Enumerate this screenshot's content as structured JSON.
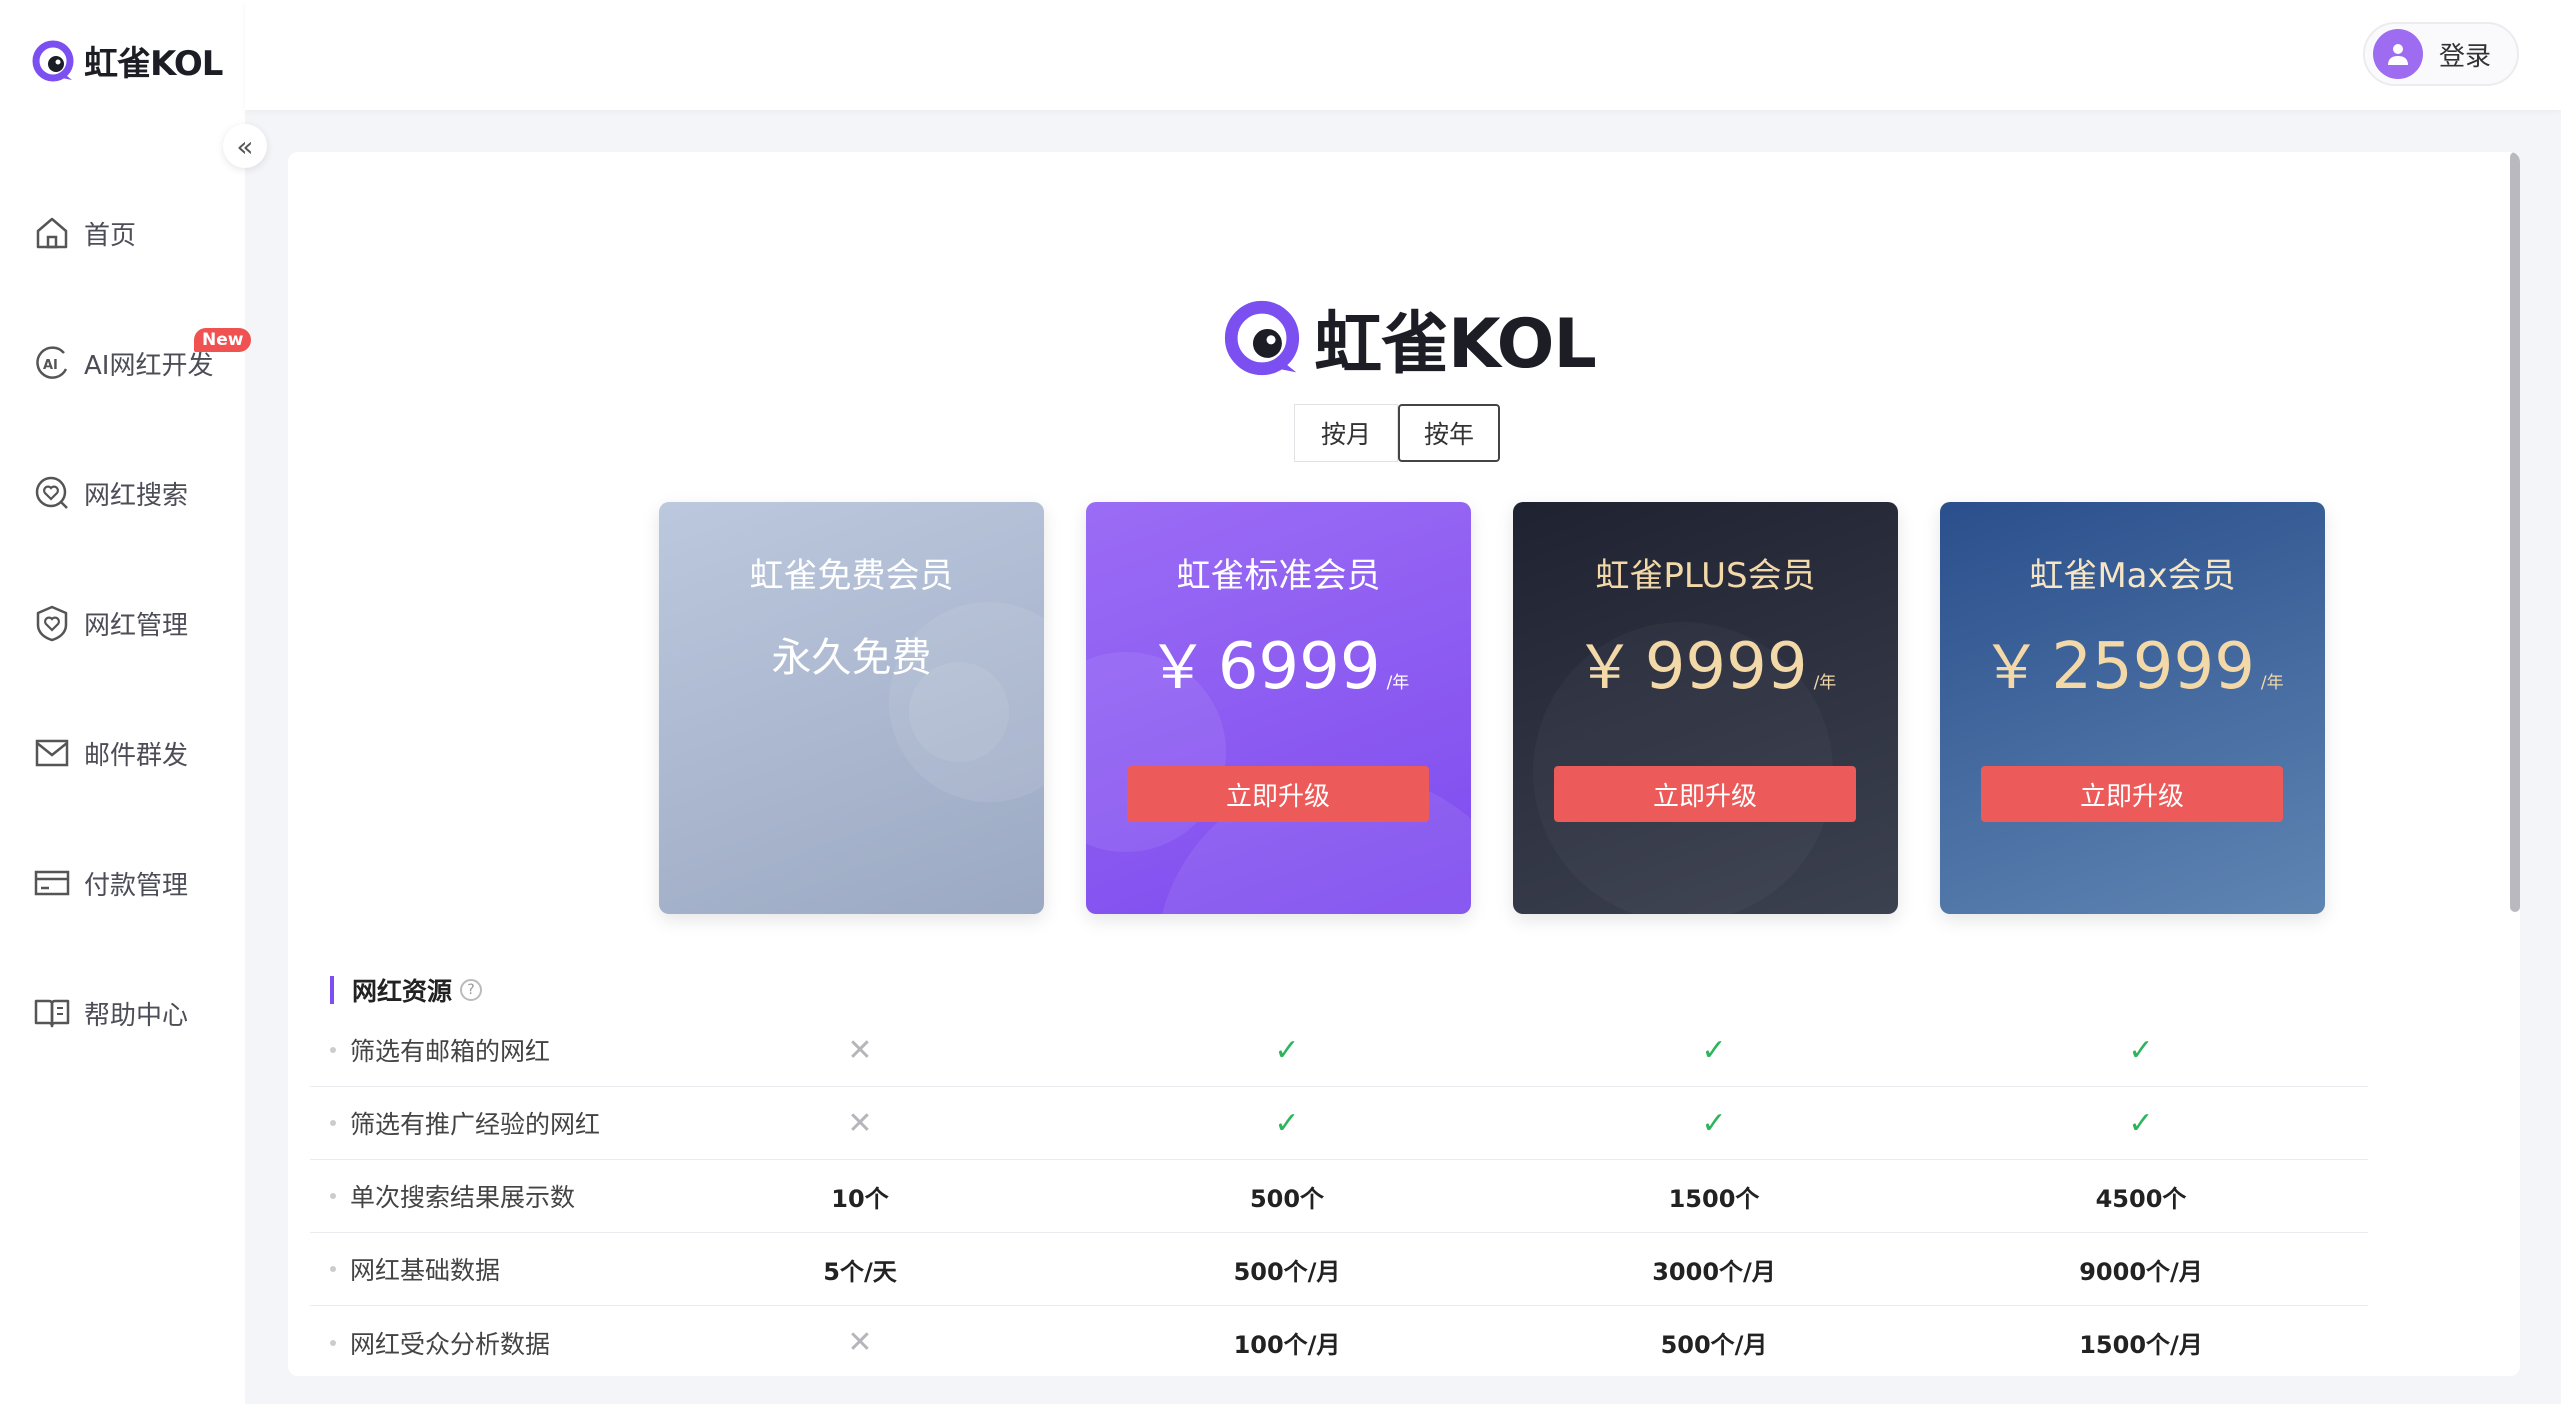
{
  "brand": {
    "name": "虹雀KOL"
  },
  "sidebar": {
    "collapse_icon": "«",
    "items": [
      {
        "label": "首页",
        "icon": "home-icon"
      },
      {
        "label": "AI网红开发",
        "icon": "ai-icon",
        "badge": "New"
      },
      {
        "label": "网红搜索",
        "icon": "search-heart-icon"
      },
      {
        "label": "网红管理",
        "icon": "manage-shield-icon"
      },
      {
        "label": "邮件群发",
        "icon": "mail-icon"
      },
      {
        "label": "付款管理",
        "icon": "card-icon"
      },
      {
        "label": "帮助中心",
        "icon": "book-icon"
      }
    ]
  },
  "header": {
    "login_label": "登录"
  },
  "toggle": {
    "monthly": "按月",
    "yearly": "按年",
    "active": "yearly"
  },
  "plans": [
    {
      "name": "虹雀免费会员",
      "price_text": "永久免费"
    },
    {
      "name": "虹雀标准会员",
      "currency": "￥",
      "price": "6999",
      "unit": "/年",
      "button": "立即升级"
    },
    {
      "name": "虹雀PLUS会员",
      "currency": "￥",
      "price": "9999",
      "unit": "/年",
      "button": "立即升级"
    },
    {
      "name": "虹雀Max会员",
      "currency": "￥",
      "price": "25999",
      "unit": "/年",
      "button": "立即升级"
    }
  ],
  "features": {
    "section_title": "网红资源",
    "help_icon": "?",
    "rows": [
      {
        "label": "筛选有邮箱的网红",
        "values": [
          "✕",
          "✓",
          "✓",
          "✓"
        ]
      },
      {
        "label": "筛选有推广经验的网红",
        "values": [
          "✕",
          "✓",
          "✓",
          "✓"
        ]
      },
      {
        "label": "单次搜索结果展示数",
        "values": [
          "10个",
          "500个",
          "1500个",
          "4500个"
        ]
      },
      {
        "label": "网红基础数据",
        "values": [
          "5个/天",
          "500个/月",
          "3000个/月",
          "9000个/月"
        ]
      },
      {
        "label": "网红受众分析数据",
        "values": [
          "✕",
          "100个/月",
          "500个/月",
          "1500个/月"
        ]
      }
    ]
  },
  "colors": {
    "accent": "#7b4ff0",
    "upgrade": "#ec5a5a",
    "check": "#2db55d",
    "cross": "#b5b5bb"
  }
}
